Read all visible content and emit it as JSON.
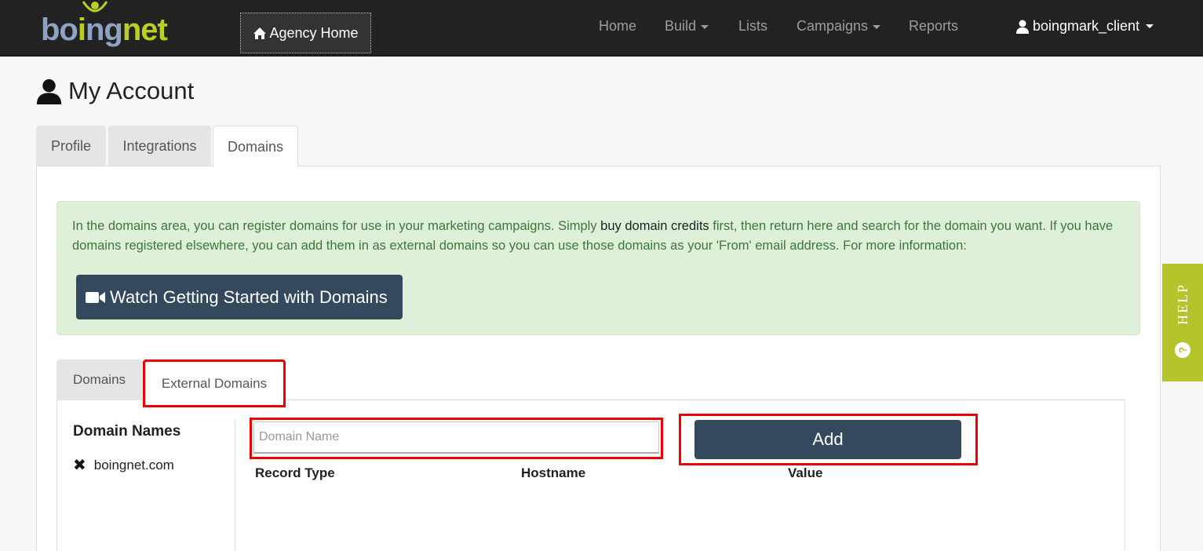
{
  "logo": {
    "part1": "bo",
    "part2": "i",
    "part3": "ng",
    "part4": "net"
  },
  "navbar": {
    "agency_home": "Agency Home",
    "links": [
      "Home",
      "Build",
      "Lists",
      "Campaigns",
      "Reports"
    ],
    "user": "boingmark_client"
  },
  "page": {
    "title": "My Account"
  },
  "tabs": [
    "Profile",
    "Integrations",
    "Domains"
  ],
  "alert": {
    "text_before": "In the domains area, you can register domains for use in your marketing campaigns. Simply ",
    "link": "buy domain credits",
    "text_after": " first, then return here and search for the domain you want. If you have domains registered elsewhere, you can add them in as external domains so you can use those domains as your 'From' email address. For more information:",
    "watch_button": "Watch Getting Started with Domains"
  },
  "sub_tabs": [
    "Domains",
    "External Domains"
  ],
  "domain_list": {
    "heading": "Domain Names",
    "items": [
      "boingnet.com"
    ]
  },
  "form": {
    "placeholder": "Domain Name",
    "value": "",
    "add_button": "Add"
  },
  "columns": [
    "Record Type",
    "Hostname",
    "Value"
  ],
  "help": {
    "label": "HELP",
    "icon_glyph": "?"
  },
  "colors": {
    "navbar": "#222222",
    "button": "#34495e",
    "alert_bg": "#dff0d8",
    "alert_text": "#3c763d",
    "help": "#b5c42a",
    "highlight": "#ee0000"
  }
}
